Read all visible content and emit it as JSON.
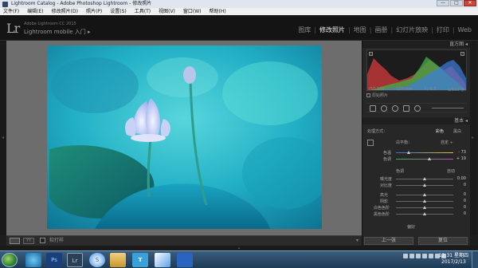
{
  "window": {
    "title": "Lightroom Catalog - Adobe Photoshop Lightroom - 修改照片",
    "buttons": [
      "—",
      "□",
      "✕"
    ]
  },
  "menu": [
    "文件(F)",
    "编辑(E)",
    "修改照片(D)",
    "照片(P)",
    "设置(S)",
    "工具(T)",
    "视图(V)",
    "窗口(W)",
    "帮助(H)"
  ],
  "identity": {
    "logo": "Lr",
    "product": "Adobe Lightroom CC 2015",
    "mobile": "Lightroom mobile 入门",
    "arrow": "▸"
  },
  "modules": [
    {
      "label": "图库",
      "active": false
    },
    {
      "label": "修改照片",
      "active": true
    },
    {
      "label": "地图",
      "active": false
    },
    {
      "label": "画册",
      "active": false
    },
    {
      "label": "幻灯片放映",
      "active": false
    },
    {
      "label": "打印",
      "active": false
    },
    {
      "label": "Web",
      "active": false
    }
  ],
  "edges": {
    "left": "◂",
    "right": "▸",
    "bottom": "▴"
  },
  "toolbar": {
    "view_button": "YY",
    "soft_proof": "软打样",
    "dropdown": "▾"
  },
  "panel": {
    "histogram_title": "直方图 ◂",
    "hist_info": [
      "ISO 100",
      "110 mm",
      "f / 6.3",
      "1/500 秒"
    ],
    "original_photo": "原始照片",
    "basic_title": "基本 ◂",
    "process_label": "处理方式：",
    "color": "彩色",
    "bw": "黑白",
    "wb_label": "白平衡：",
    "wb_value": "自定 ÷",
    "temp_label": "色温",
    "temp_value": "- 73",
    "tint_label": "色调",
    "tint_value": "+ 19",
    "tone": "色调",
    "auto": "自动",
    "exposure_label": "曝光度",
    "exposure_value": "0.00",
    "contrast_label": "对比度",
    "contrast_value": "0",
    "highlights_label": "高光",
    "highlights_value": "0",
    "shadows_label": "阴影",
    "shadows_value": "0",
    "whites_label": "白色色阶",
    "whites_value": "0",
    "blacks_label": "黑色色阶",
    "blacks_value": "0",
    "presence": "偏好"
  },
  "bottom_buttons": {
    "previous": "上一张",
    "reset": "复位"
  },
  "taskbar": {
    "apps": [
      "Ps",
      "Lr",
      "S",
      "T"
    ],
    "time": "12:31 星期四",
    "date": "2017/2/13"
  },
  "colors": {
    "accent": "#eeeeee",
    "panel": "#272727",
    "photo_cyan": "#2ec8d8",
    "taskbar": "#2b4c6a"
  },
  "icons": [
    "app-icon",
    "histogram-icon",
    "crop-icon",
    "spot-removal-icon",
    "red-eye-icon",
    "graduated-filter-icon",
    "radial-filter-icon",
    "brush-icon",
    "eyedropper-icon",
    "start-orb-icon",
    "ie-icon",
    "explorer-icon",
    "folder-icon",
    "photoshop-icon",
    "lightroom-icon",
    "sogou-icon",
    "typora-icon",
    "word-icon"
  ]
}
